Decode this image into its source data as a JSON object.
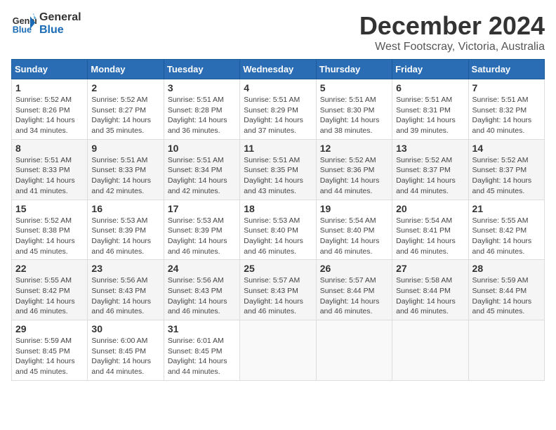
{
  "logo": {
    "line1": "General",
    "line2": "Blue"
  },
  "title": "December 2024",
  "subtitle": "West Footscray, Victoria, Australia",
  "days_of_week": [
    "Sunday",
    "Monday",
    "Tuesday",
    "Wednesday",
    "Thursday",
    "Friday",
    "Saturday"
  ],
  "weeks": [
    [
      {
        "day": "1",
        "sunrise": "5:52 AM",
        "sunset": "8:26 PM",
        "daylight": "14 hours and 34 minutes."
      },
      {
        "day": "2",
        "sunrise": "5:52 AM",
        "sunset": "8:27 PM",
        "daylight": "14 hours and 35 minutes."
      },
      {
        "day": "3",
        "sunrise": "5:51 AM",
        "sunset": "8:28 PM",
        "daylight": "14 hours and 36 minutes."
      },
      {
        "day": "4",
        "sunrise": "5:51 AM",
        "sunset": "8:29 PM",
        "daylight": "14 hours and 37 minutes."
      },
      {
        "day": "5",
        "sunrise": "5:51 AM",
        "sunset": "8:30 PM",
        "daylight": "14 hours and 38 minutes."
      },
      {
        "day": "6",
        "sunrise": "5:51 AM",
        "sunset": "8:31 PM",
        "daylight": "14 hours and 39 minutes."
      },
      {
        "day": "7",
        "sunrise": "5:51 AM",
        "sunset": "8:32 PM",
        "daylight": "14 hours and 40 minutes."
      }
    ],
    [
      {
        "day": "8",
        "sunrise": "5:51 AM",
        "sunset": "8:33 PM",
        "daylight": "14 hours and 41 minutes."
      },
      {
        "day": "9",
        "sunrise": "5:51 AM",
        "sunset": "8:33 PM",
        "daylight": "14 hours and 42 minutes."
      },
      {
        "day": "10",
        "sunrise": "5:51 AM",
        "sunset": "8:34 PM",
        "daylight": "14 hours and 42 minutes."
      },
      {
        "day": "11",
        "sunrise": "5:51 AM",
        "sunset": "8:35 PM",
        "daylight": "14 hours and 43 minutes."
      },
      {
        "day": "12",
        "sunrise": "5:52 AM",
        "sunset": "8:36 PM",
        "daylight": "14 hours and 44 minutes."
      },
      {
        "day": "13",
        "sunrise": "5:52 AM",
        "sunset": "8:37 PM",
        "daylight": "14 hours and 44 minutes."
      },
      {
        "day": "14",
        "sunrise": "5:52 AM",
        "sunset": "8:37 PM",
        "daylight": "14 hours and 45 minutes."
      }
    ],
    [
      {
        "day": "15",
        "sunrise": "5:52 AM",
        "sunset": "8:38 PM",
        "daylight": "14 hours and 45 minutes."
      },
      {
        "day": "16",
        "sunrise": "5:53 AM",
        "sunset": "8:39 PM",
        "daylight": "14 hours and 46 minutes."
      },
      {
        "day": "17",
        "sunrise": "5:53 AM",
        "sunset": "8:39 PM",
        "daylight": "14 hours and 46 minutes."
      },
      {
        "day": "18",
        "sunrise": "5:53 AM",
        "sunset": "8:40 PM",
        "daylight": "14 hours and 46 minutes."
      },
      {
        "day": "19",
        "sunrise": "5:54 AM",
        "sunset": "8:40 PM",
        "daylight": "14 hours and 46 minutes."
      },
      {
        "day": "20",
        "sunrise": "5:54 AM",
        "sunset": "8:41 PM",
        "daylight": "14 hours and 46 minutes."
      },
      {
        "day": "21",
        "sunrise": "5:55 AM",
        "sunset": "8:42 PM",
        "daylight": "14 hours and 46 minutes."
      }
    ],
    [
      {
        "day": "22",
        "sunrise": "5:55 AM",
        "sunset": "8:42 PM",
        "daylight": "14 hours and 46 minutes."
      },
      {
        "day": "23",
        "sunrise": "5:56 AM",
        "sunset": "8:43 PM",
        "daylight": "14 hours and 46 minutes."
      },
      {
        "day": "24",
        "sunrise": "5:56 AM",
        "sunset": "8:43 PM",
        "daylight": "14 hours and 46 minutes."
      },
      {
        "day": "25",
        "sunrise": "5:57 AM",
        "sunset": "8:43 PM",
        "daylight": "14 hours and 46 minutes."
      },
      {
        "day": "26",
        "sunrise": "5:57 AM",
        "sunset": "8:44 PM",
        "daylight": "14 hours and 46 minutes."
      },
      {
        "day": "27",
        "sunrise": "5:58 AM",
        "sunset": "8:44 PM",
        "daylight": "14 hours and 46 minutes."
      },
      {
        "day": "28",
        "sunrise": "5:59 AM",
        "sunset": "8:44 PM",
        "daylight": "14 hours and 45 minutes."
      }
    ],
    [
      {
        "day": "29",
        "sunrise": "5:59 AM",
        "sunset": "8:45 PM",
        "daylight": "14 hours and 45 minutes."
      },
      {
        "day": "30",
        "sunrise": "6:00 AM",
        "sunset": "8:45 PM",
        "daylight": "14 hours and 44 minutes."
      },
      {
        "day": "31",
        "sunrise": "6:01 AM",
        "sunset": "8:45 PM",
        "daylight": "14 hours and 44 minutes."
      },
      null,
      null,
      null,
      null
    ]
  ]
}
